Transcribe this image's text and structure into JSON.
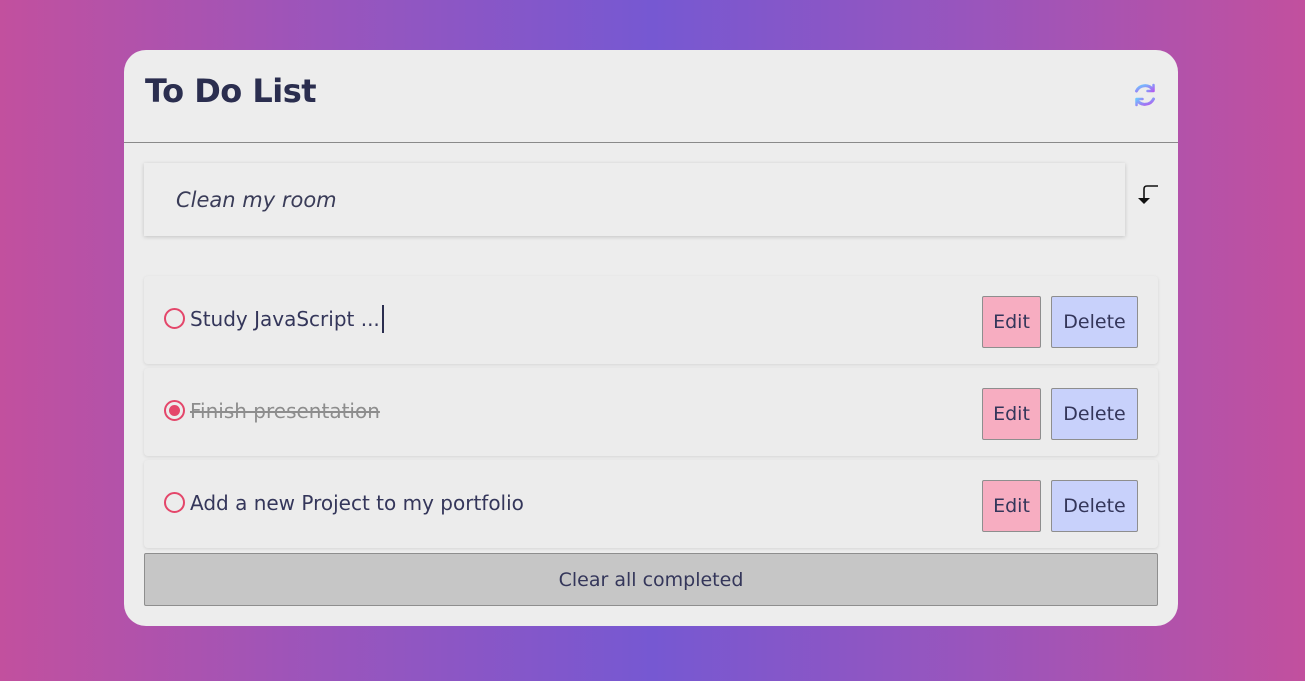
{
  "app": {
    "title": "To Do List"
  },
  "header": {
    "refresh_icon": "refresh-icon"
  },
  "input": {
    "value": "",
    "placeholder": "Clean my room",
    "submit_icon": "enter-icon"
  },
  "tasks": [
    {
      "text": "Study JavaScript ...",
      "completed": false,
      "edit_label": "Edit",
      "delete_label": "Delete"
    },
    {
      "text": "Finish presentation",
      "completed": true,
      "edit_label": "Edit",
      "delete_label": "Delete"
    },
    {
      "text": "Add a new Project to my portfolio",
      "completed": false,
      "edit_label": "Edit",
      "delete_label": "Delete"
    }
  ],
  "footer": {
    "clear_label": "Clear all completed"
  },
  "colors": {
    "accent": "#e4466a",
    "edit": "#f7adc1",
    "delete": "#c8d1fb",
    "text": "#2b2e4f"
  }
}
